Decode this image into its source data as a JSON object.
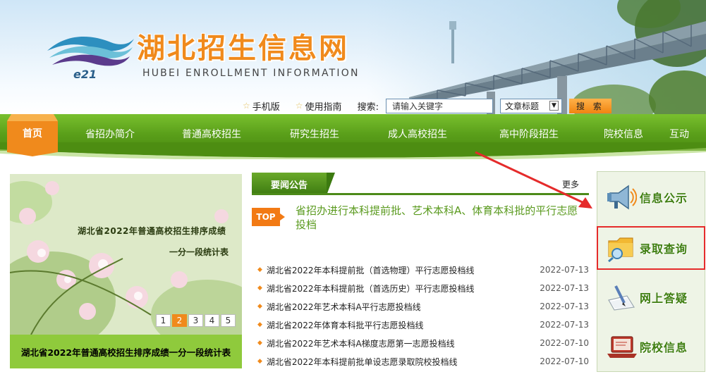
{
  "header": {
    "title": "湖北招生信息网",
    "subtitle": "HUBEI ENROLLMENT INFORMATION",
    "logo_text": "e21"
  },
  "tools": {
    "mobile": "手机版",
    "guide": "使用指南",
    "search_label": "搜索:",
    "search_value": "请输入关键字",
    "search_type": "文章标题",
    "search_button": "搜 索"
  },
  "nav": {
    "items": [
      "首页",
      "省招办简介",
      "普通高校招生",
      "研究生招生",
      "成人高校招生",
      "高中阶段招生",
      "院校信息",
      "互动"
    ]
  },
  "slideshow": {
    "line1": "湖北省2022年普通高校招生排序成绩",
    "line2": "一分一段统计表",
    "pages": [
      "1",
      "2",
      "3",
      "4",
      "5"
    ],
    "active_page": "2",
    "caption": "湖北省2022年普通高校招生排序成绩一分一段统计表"
  },
  "news": {
    "tab": "要闻公告",
    "more": "更多",
    "top_badge": "TOP",
    "top_headline": "省招办进行本科提前批、艺术本科A、体育本科批的平行志愿投档",
    "items": [
      {
        "title": "湖北省2022年本科提前批（首选物理）平行志愿投档线",
        "date": "2022-07-13"
      },
      {
        "title": "湖北省2022年本科提前批（首选历史）平行志愿投档线",
        "date": "2022-07-13"
      },
      {
        "title": "湖北省2022年艺术本科A平行志愿投档线",
        "date": "2022-07-13"
      },
      {
        "title": "湖北省2022年体育本科批平行志愿投档线",
        "date": "2022-07-13"
      },
      {
        "title": "湖北省2022年艺术本科A梯度志愿第一志愿投档线",
        "date": "2022-07-10"
      },
      {
        "title": "湖北省2022年本科提前批单设志愿录取院校投档线",
        "date": "2022-07-10"
      }
    ]
  },
  "sidebar": {
    "items": [
      {
        "label": "信息公示",
        "icon": "megaphone-icon"
      },
      {
        "label": "录取查询",
        "icon": "folder-search-icon"
      },
      {
        "label": "网上答疑",
        "icon": "pen-paper-icon"
      },
      {
        "label": "院校信息",
        "icon": "laptop-icon"
      }
    ]
  },
  "colors": {
    "nav_green": "#5a9f1a",
    "brand_orange": "#f08a1c",
    "highlight_red": "#e52b2b"
  }
}
